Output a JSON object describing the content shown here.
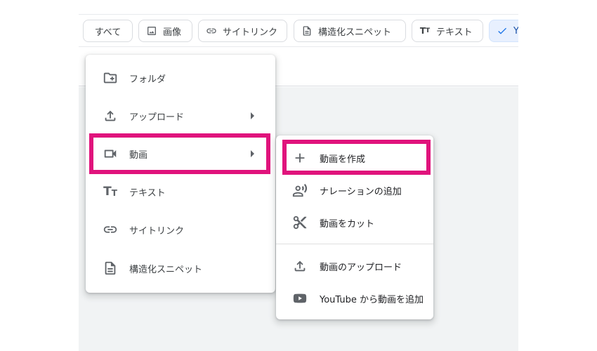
{
  "filter_chips": [
    {
      "label": "すべて",
      "icon": null
    },
    {
      "label": "画像",
      "icon": "image-icon"
    },
    {
      "label": "サイトリンク",
      "icon": "link-icon"
    },
    {
      "label": "構造化スニペット",
      "icon": "document-icon"
    },
    {
      "label": "テキスト",
      "icon": "text-icon"
    },
    {
      "label": "Yo",
      "icon": "check-icon",
      "selected": true
    }
  ],
  "main_menu": {
    "items": [
      {
        "label": "フォルダ",
        "icon": "add-folder-icon",
        "has_submenu": false
      },
      {
        "label": "アップロード",
        "icon": "upload-icon",
        "has_submenu": true
      },
      {
        "label": "動画",
        "icon": "video-icon",
        "has_submenu": true,
        "highlighted": true
      },
      {
        "label": "テキスト",
        "icon": "text-icon",
        "has_submenu": false
      },
      {
        "label": "サイトリンク",
        "icon": "link-icon",
        "has_submenu": false
      },
      {
        "label": "構造化スニペット",
        "icon": "document-icon",
        "has_submenu": false
      }
    ]
  },
  "video_submenu": {
    "items": [
      {
        "label": "動画を作成",
        "icon": "plus-icon",
        "highlighted": true
      },
      {
        "label": "ナレーションの追加",
        "icon": "narration-icon"
      },
      {
        "label": "動画をカット",
        "icon": "scissors-icon"
      },
      {
        "label": "動画のアップロード",
        "icon": "upload-icon"
      },
      {
        "label": "YouTube から動画を追加",
        "icon": "youtube-icon"
      }
    ]
  },
  "colors": {
    "highlight": "#e0137c",
    "selected_chip_bg": "#e8f0fe",
    "selected_chip_text": "#174ea6",
    "icon_gray": "#5f6368"
  }
}
